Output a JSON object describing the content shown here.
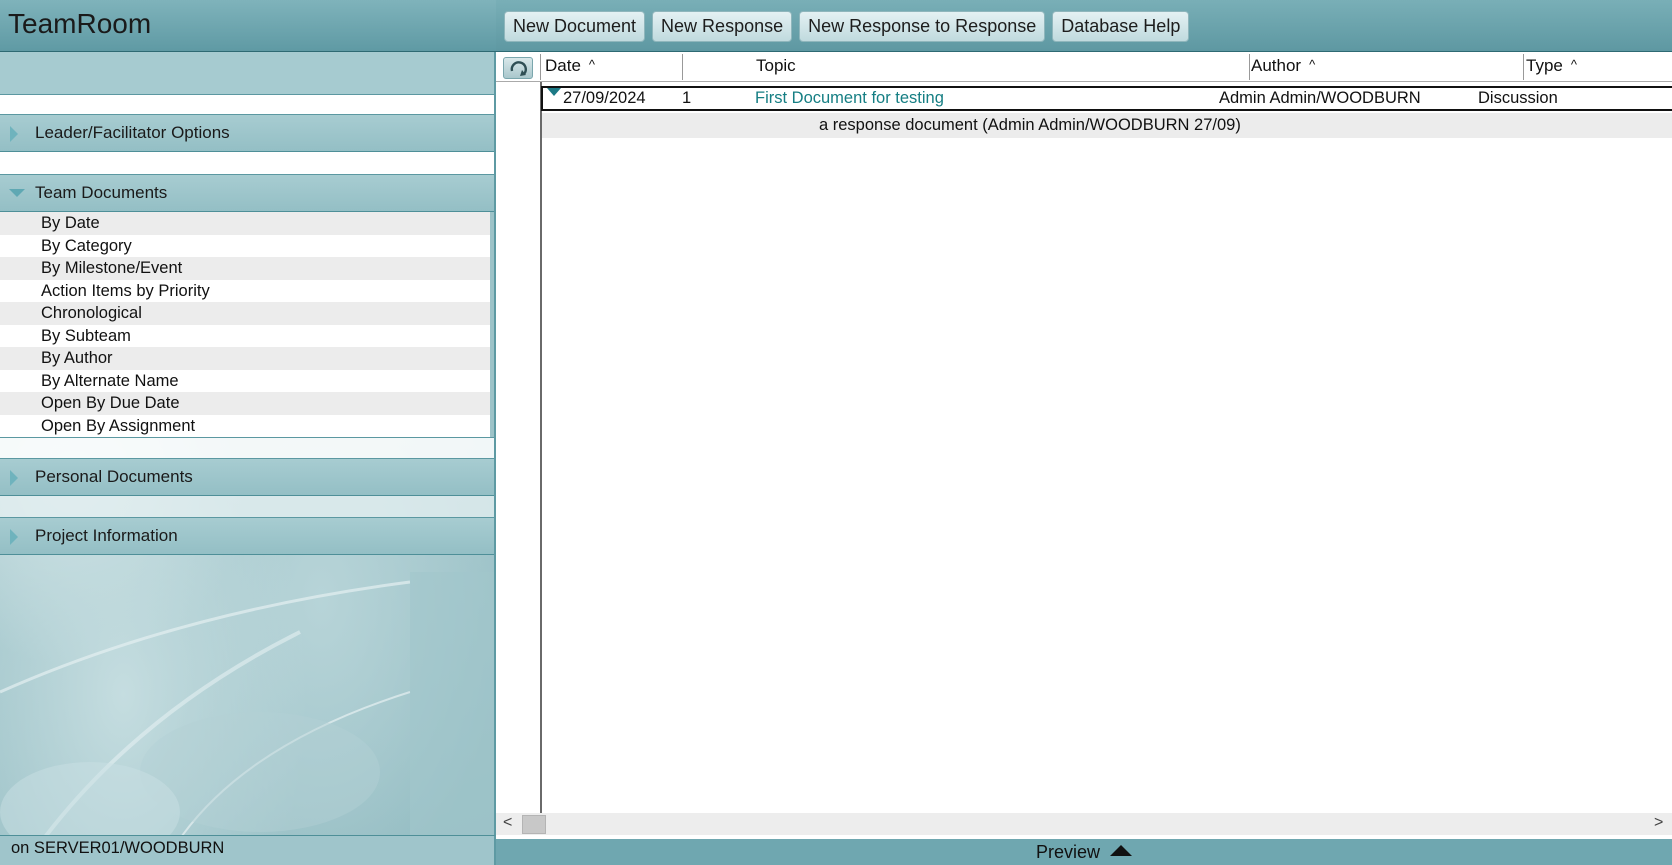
{
  "app": {
    "title": "TeamRoom"
  },
  "actions": [
    {
      "label": "New Document"
    },
    {
      "label": "New Response"
    },
    {
      "label": "New Response to Response"
    },
    {
      "label": "Database Help"
    }
  ],
  "navigator": {
    "sections": {
      "leader": {
        "label": "Leader/Facilitator Options",
        "expanded": false
      },
      "team": {
        "label": "Team Documents",
        "expanded": true,
        "items": [
          {
            "label": "By Date"
          },
          {
            "label": "By Category"
          },
          {
            "label": "By Milestone/Event"
          },
          {
            "label": "Action Items by Priority"
          },
          {
            "label": "Chronological"
          },
          {
            "label": "By Subteam"
          },
          {
            "label": "By Author"
          },
          {
            "label": "By Alternate Name"
          },
          {
            "label": "Open By Due Date"
          },
          {
            "label": "Open By Assignment"
          }
        ]
      },
      "personal": {
        "label": "Personal Documents",
        "expanded": false
      },
      "project": {
        "label": "Project Information",
        "expanded": false
      }
    }
  },
  "view": {
    "columns": {
      "date": {
        "label": "Date",
        "sort": "^"
      },
      "topic": {
        "label": "Topic"
      },
      "author": {
        "label": "Author",
        "sort": "^"
      },
      "type": {
        "label": "Type",
        "sort": "^"
      }
    },
    "rows": [
      {
        "date": "27/09/2024",
        "count": "1",
        "topic": "First Document for testing",
        "author": "Admin Admin/WOODBURN",
        "type": "Discussion",
        "response": "a response document  (Admin Admin/WOODBURN 27/09)"
      }
    ]
  },
  "scrollbar": {
    "left": "<",
    "right": ">"
  },
  "status": {
    "server": "on SERVER01/WOODBURN"
  },
  "preview": {
    "label": "Preview"
  },
  "colors": {
    "accent": "#6fa7b0",
    "link": "#157e83",
    "header": "#94bfc5"
  }
}
